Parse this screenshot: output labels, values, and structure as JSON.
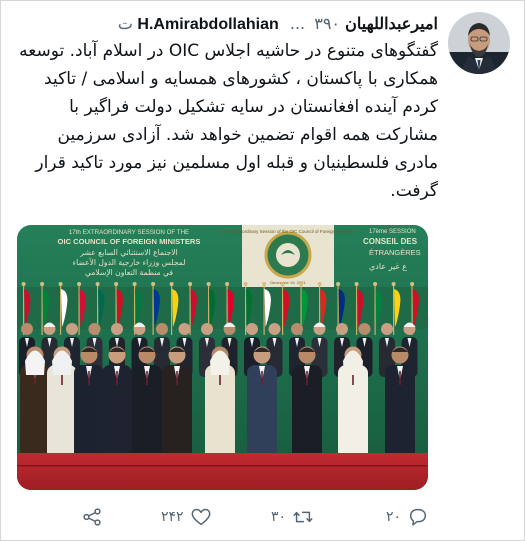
{
  "tweet": {
    "name": "امیرعبداللهیان",
    "handle": "H.Amirabdollahian",
    "ellipsis": "...",
    "dot": "·",
    "time": "۳۹۰ ت",
    "text": "گفتگوهای متنوع در حاشیه اجلاس OIC در اسلام آباد. توسعه همکاری با پاکستان ، کشورهای همسایه و اسلامی / تاکید کردم آینده افغانستان در سایه تشکیل دولت فراگیر با مشارکت همه اقوام تضمین خواهد شد. آزادی سرزمین مادری فلسطینیان و قبله اول مسلمین نیز مورد تاکید قرار گرفت."
  },
  "photo": {
    "banner_left_line1": "17th EXTRAORDINARY SESSION OF THE",
    "banner_left_line2": "OIC COUNCIL OF FOREIGN MINISTERS",
    "banner_left_arabic1": "الاجتماع الاستثنائي السابع عشر",
    "banner_left_arabic2": "لمجلس وزراء خارجية الدول الأعضاء",
    "banner_left_arabic3": "في منظمة التعاون الإسلامي",
    "banner_right_line1": "17ème SESSION",
    "banner_right_line2": "CONSEIL DES",
    "banner_right_line3": "ÉTRANGÈRES",
    "banner_right_arabic": "ع غير عادي",
    "banner_center": "17th Extraordinary Session of the OIC Council of Foreign Ministers",
    "banner_center_date": "December 19, 2021"
  },
  "actions": {
    "replies": "۲۰",
    "retweets": "۳۰",
    "likes": "۲۴۲"
  },
  "colors": {
    "banner_green": "#1e6e4a",
    "carpet_red": "#b8262c",
    "text": "#0f1419",
    "muted": "#536471"
  }
}
